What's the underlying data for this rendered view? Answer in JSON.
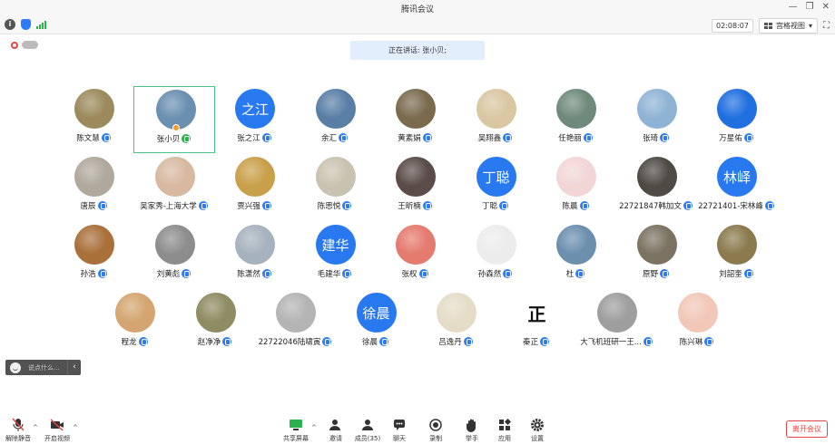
{
  "window": {
    "title": "腾讯会议"
  },
  "toolbar": {
    "timer": "02:08:07",
    "view_label": "宫格视图"
  },
  "speaking_banner": "正在讲话: 张小贝;",
  "participants": [
    {
      "name": "陈文慧",
      "avatar": "photo",
      "color": "#9a8a5c"
    },
    {
      "name": "张小贝",
      "avatar": "photo",
      "color": "#6b8fb0",
      "active": true
    },
    {
      "name": "张之江",
      "avatar": "text",
      "avatar_text": "之江"
    },
    {
      "name": "余汇",
      "avatar": "photo",
      "color": "#5a7fa6"
    },
    {
      "name": "黄素娟",
      "avatar": "photo",
      "color": "#7a6b4f"
    },
    {
      "name": "吴翔鑫",
      "avatar": "photo",
      "color": "#d9c6a3"
    },
    {
      "name": "任艳丽",
      "avatar": "photo",
      "color": "#6f8a7a"
    },
    {
      "name": "张琦",
      "avatar": "photo",
      "color": "#8fb3d4"
    },
    {
      "name": "万星佑",
      "avatar": "photo",
      "color": "#1f6fe0"
    },
    {
      "name": "唐辰",
      "avatar": "photo",
      "color": "#b0a89c"
    },
    {
      "name": "吴家秀-上海大学",
      "avatar": "photo",
      "color": "#d8b9a0"
    },
    {
      "name": "贾兴强",
      "avatar": "photo",
      "color": "#c9a04a"
    },
    {
      "name": "陈思悦",
      "avatar": "photo",
      "color": "#c9c2b0"
    },
    {
      "name": "王昕楠",
      "avatar": "photo",
      "color": "#5a4c48"
    },
    {
      "name": "丁聪",
      "avatar": "text",
      "avatar_text": "丁聪"
    },
    {
      "name": "陈晨",
      "avatar": "photo",
      "color": "#f2d6d6"
    },
    {
      "name": "22721847韩加文",
      "avatar": "photo",
      "color": "#4e4a44"
    },
    {
      "name": "22721401-宋林峰",
      "avatar": "text",
      "avatar_text": "林峄"
    },
    {
      "name": "孙浩",
      "avatar": "photo",
      "color": "#a9703a"
    },
    {
      "name": "刘黄彪",
      "avatar": "photo",
      "color": "#8d8d8d"
    },
    {
      "name": "陈潇然",
      "avatar": "photo",
      "color": "#a6b2bd"
    },
    {
      "name": "毛建华",
      "avatar": "text",
      "avatar_text": "建华"
    },
    {
      "name": "张权",
      "avatar": "photo",
      "color": "#e57a6e"
    },
    {
      "name": "孙森然",
      "avatar": "photo",
      "color": "#ececec"
    },
    {
      "name": "杜",
      "avatar": "photo",
      "color": "#6c8fae"
    },
    {
      "name": "原野",
      "avatar": "photo",
      "color": "#7b7262"
    },
    {
      "name": "刘韶奎",
      "avatar": "photo",
      "color": "#8a7a4e"
    },
    {
      "name": "程龙",
      "avatar": "photo",
      "color": "#d4a570"
    },
    {
      "name": "赵净净",
      "avatar": "photo",
      "color": "#8f8b62"
    },
    {
      "name": "22722046陆啸寅",
      "avatar": "photo",
      "color": "#b4b4b4"
    },
    {
      "name": "徐晨",
      "avatar": "text",
      "avatar_text": "徐晨"
    },
    {
      "name": "吕逸丹",
      "avatar": "photo",
      "color": "#e5dcc8"
    },
    {
      "name": "秦正",
      "avatar": "text-dark",
      "avatar_text": "正"
    },
    {
      "name": "大飞机班研一王...",
      "avatar": "photo",
      "color": "#9e9e9e"
    },
    {
      "name": "陈兴琳",
      "avatar": "photo",
      "color": "#f1c7b8"
    }
  ],
  "chat": {
    "placeholder": "说点什么..."
  },
  "bottom": {
    "unmute": "解除静音",
    "video": "开启视频",
    "share": "共享屏幕",
    "invite": "邀请",
    "members": "成员(35)",
    "chat": "聊天",
    "record": "录制",
    "raise": "举手",
    "apps": "应用",
    "settings": "设置",
    "leave": "离开会议"
  }
}
